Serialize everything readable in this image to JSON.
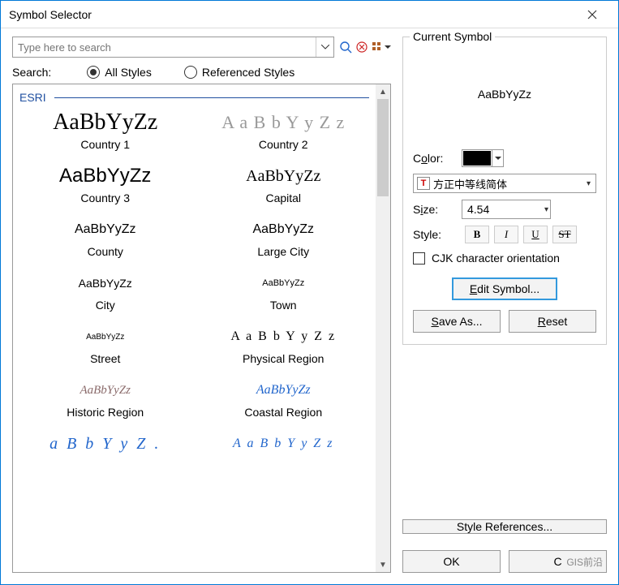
{
  "window": {
    "title": "Symbol Selector"
  },
  "search": {
    "placeholder": "Type here to search",
    "label": "Search:"
  },
  "filter": {
    "allStyles": "All Styles",
    "referencedStyles": "Referenced Styles",
    "selected": "all"
  },
  "group": {
    "name": "ESRI"
  },
  "symbols": [
    {
      "label": "Country 1",
      "sample": "AaBbYyZz",
      "css": "font-family:'Times New Roman',serif;font-size:28px;"
    },
    {
      "label": "Country 2",
      "sample": "A a  B  b  Y  y  Z  z",
      "css": "font-family:'Times New Roman',serif;font-size:22px;color:#999;letter-spacing:1px;"
    },
    {
      "label": "Country 3",
      "sample": "AaBbYyZz",
      "css": "font-family:Arial,sans-serif;font-size:24px;"
    },
    {
      "label": "Capital",
      "sample": "AaBbYyZz",
      "css": "font-family:'Times New Roman',serif;font-size:20px;"
    },
    {
      "label": "County",
      "sample": "AaBbYyZz",
      "css": "font-family:Arial,sans-serif;font-size:16px;"
    },
    {
      "label": "Large City",
      "sample": "AaBbYyZz",
      "css": "font-family:Arial,sans-serif;font-size:16px;"
    },
    {
      "label": "City",
      "sample": "AaBbYyZz",
      "css": "font-family:Arial,sans-serif;font-size:14px;"
    },
    {
      "label": "Town",
      "sample": "AaBbYyZz",
      "css": "font-family:Arial,sans-serif;font-size:11px;"
    },
    {
      "label": "Street",
      "sample": "AaBbYyZz",
      "css": "font-family:Arial,sans-serif;font-size:10px;"
    },
    {
      "label": "Physical Region",
      "sample": "A  a   B   b   Y   y   Z   z",
      "css": "font-family:'Times New Roman',serif;font-size:16px;letter-spacing:2px;"
    },
    {
      "label": "Historic Region",
      "sample": "AaBbYyZz",
      "css": "font-family:'Times New Roman',serif;font-size:15px;font-style:italic;color:#8a6a6a;"
    },
    {
      "label": "Coastal Region",
      "sample": "AaBbYyZz",
      "css": "font-family:'Times New Roman',serif;font-size:16px;font-style:italic;color:#2266cc;"
    },
    {
      "label": "",
      "sample": "a  B  b   Y  y  Z .",
      "css": "font-family:'Times New Roman',serif;font-size:20px;font-style:italic;color:#2266cc;letter-spacing:3px;"
    },
    {
      "label": "",
      "sample": "A a  B  b  Y  y  Z  z",
      "css": "font-family:'Times New Roman',serif;font-size:16px;font-style:italic;color:#2266cc;letter-spacing:2px;"
    }
  ],
  "currentSymbol": {
    "title": "Current Symbol",
    "preview": "AaBbYyZz",
    "colorLabel": "Color:",
    "colorLabelLetter": "o",
    "colorValue": "#000000",
    "fontName": "方正中等线简体",
    "sizeLabel": "Size:",
    "sizeLabelLetter": "i",
    "sizeValue": "4.54",
    "styleLabel": "Style:",
    "bold": "B",
    "italic": "I",
    "underline": "U",
    "strike": "ST",
    "cjkLabel": "CJK character orientation",
    "editSymbol": "Edit Symbol...",
    "editSymbolLetter": "E",
    "saveAs": "Save As...",
    "saveAsLetter": "S",
    "reset": "Reset",
    "resetLetter": "R"
  },
  "buttons": {
    "styleRefs": "Style References...",
    "ok": "OK",
    "cancel": "Cancel"
  },
  "watermark": "GIS前沿"
}
